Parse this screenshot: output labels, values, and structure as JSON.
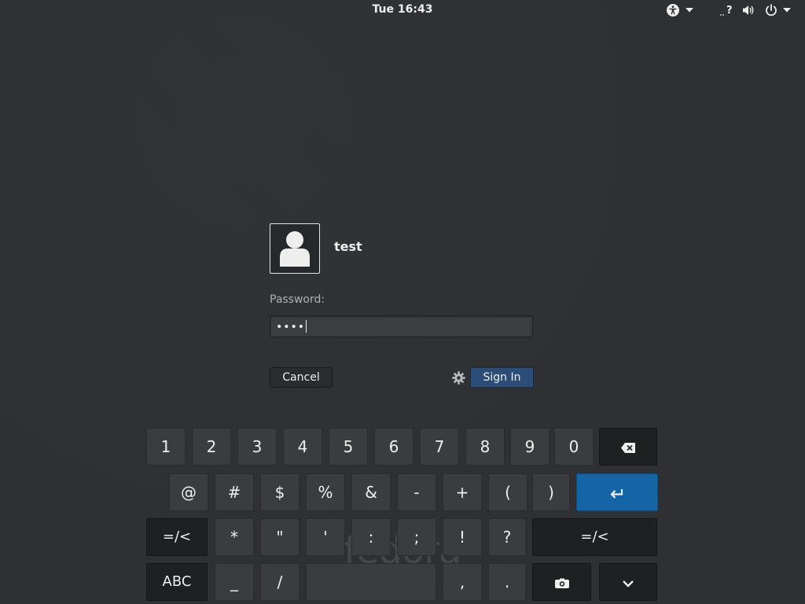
{
  "topbar": {
    "clock": "Tue 16:43",
    "icons": [
      "accessibility-icon",
      "chevron-down-icon",
      "network-unknown-icon",
      "volume-icon",
      "power-icon",
      "chevron-down-icon"
    ]
  },
  "login": {
    "username": "test",
    "password_label": "Password:",
    "password_value": "••••",
    "cancel_label": "Cancel",
    "signin_label": "Sign In",
    "settings_icon": "gear-icon"
  },
  "keyboard": {
    "row1": [
      "1",
      "2",
      "3",
      "4",
      "5",
      "6",
      "7",
      "8",
      "9",
      "0"
    ],
    "row2": [
      "@",
      "#",
      "$",
      "%",
      "&",
      "-",
      "+",
      "(",
      ")"
    ],
    "row3": [
      "=/<",
      "*",
      "\"",
      "'",
      ":",
      ";",
      "!",
      "?",
      "=/<"
    ],
    "row4": [
      "ABC",
      "_",
      "/",
      "",
      ",",
      "."
    ],
    "icons": [
      "backspace-icon",
      "enter-icon",
      "emoji-icon",
      "hide-keyboard-icon"
    ]
  },
  "watermark": "fedora",
  "colors": {
    "background": "#2d3032",
    "key": "#3a3d40",
    "key_dark": "#1e2022",
    "key_enter": "#1565a6",
    "signin_button": "#2c4d78"
  }
}
